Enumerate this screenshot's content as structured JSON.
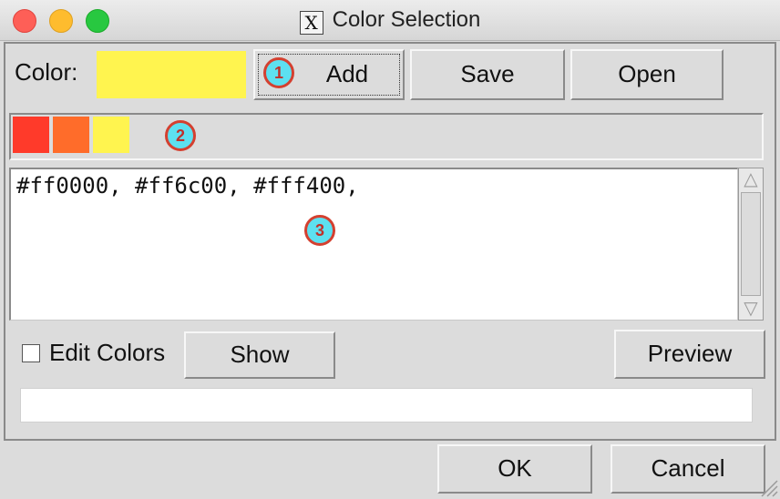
{
  "window": {
    "title": "Color Selection",
    "title_icon": "x11-icon"
  },
  "toolbar": {
    "color_label": "Color:",
    "current_color": "#fff44f",
    "add_label": "Add",
    "save_label": "Save",
    "open_label": "Open"
  },
  "palette": {
    "swatches": [
      "#ff3a2a",
      "#ff6c2a",
      "#fff44f"
    ]
  },
  "colors_text": "#ff0000, #ff6c00, #fff400,",
  "options": {
    "edit_colors_label": "Edit Colors",
    "edit_colors_checked": false,
    "show_label": "Show",
    "preview_label": "Preview"
  },
  "status_text": "",
  "dialog": {
    "ok_label": "OK",
    "cancel_label": "Cancel"
  },
  "annotations": [
    "1",
    "2",
    "3"
  ],
  "colors": {
    "badge_fill": "#5de0f0",
    "badge_border": "#d44030"
  }
}
